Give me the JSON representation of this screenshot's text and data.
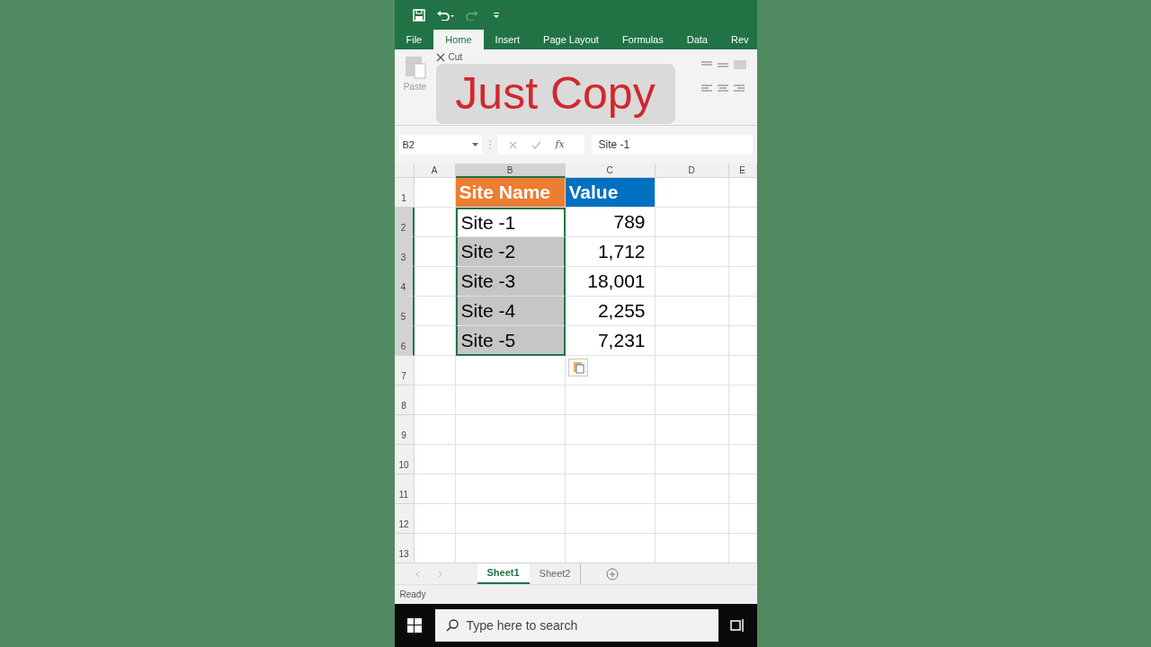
{
  "ribbon_tabs": [
    {
      "label": "File",
      "selected": false
    },
    {
      "label": "Home",
      "selected": true
    },
    {
      "label": "Insert",
      "selected": false
    },
    {
      "label": "Page Layout",
      "selected": false
    },
    {
      "label": "Formulas",
      "selected": false
    },
    {
      "label": "Data",
      "selected": false
    },
    {
      "label": "Rev",
      "selected": false
    }
  ],
  "ribbon": {
    "cut_label": "Cut",
    "paste_label": "Paste"
  },
  "overlay_caption": "Just Copy",
  "formula_bar": {
    "name_box": "B2",
    "function_label": "fx",
    "value": "Site -1"
  },
  "sheet": {
    "columns": [
      {
        "label": "A",
        "selected": false
      },
      {
        "label": "B",
        "selected": true
      },
      {
        "label": "C",
        "selected": false
      },
      {
        "label": "D",
        "selected": false
      },
      {
        "label": "E",
        "selected": false
      }
    ],
    "rows": [
      {
        "number": "1",
        "selected": false,
        "b": {
          "text": "Site Name",
          "color": "#ed7d31"
        },
        "c": {
          "text": "Value",
          "color": "#0070c0"
        }
      },
      {
        "number": "2",
        "selected": true,
        "b": {
          "text": "Site -1",
          "selected": true,
          "active": true
        },
        "c": {
          "text": "789"
        }
      },
      {
        "number": "3",
        "selected": true,
        "b": {
          "text": "Site -2",
          "selected": true,
          "active": false
        },
        "c": {
          "text": "1,712"
        }
      },
      {
        "number": "4",
        "selected": true,
        "b": {
          "text": "Site -3",
          "selected": true,
          "active": false
        },
        "c": {
          "text": "18,001"
        }
      },
      {
        "number": "5",
        "selected": true,
        "b": {
          "text": "Site -4",
          "selected": true,
          "active": false
        },
        "c": {
          "text": "2,255"
        }
      },
      {
        "number": "6",
        "selected": true,
        "b": {
          "text": "Site -5",
          "selected": true,
          "active": false
        },
        "c": {
          "text": "7,231"
        }
      },
      {
        "number": "7",
        "selected": false
      },
      {
        "number": "8",
        "selected": false
      },
      {
        "number": "9",
        "selected": false
      },
      {
        "number": "10",
        "selected": false
      },
      {
        "number": "11",
        "selected": false
      },
      {
        "number": "12",
        "selected": false
      },
      {
        "number": "13",
        "selected": false
      }
    ]
  },
  "sheet_tabs": [
    {
      "label": "Sheet1",
      "selected": true
    },
    {
      "label": "Sheet2",
      "selected": false
    }
  ],
  "status_bar": "Ready",
  "taskbar": {
    "search_placeholder": "Type here to search"
  }
}
